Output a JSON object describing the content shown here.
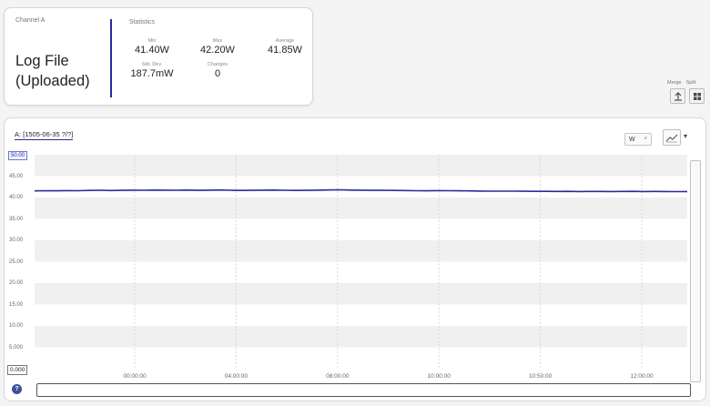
{
  "summary": {
    "channel_label": "Channel A",
    "log_title": "Log File\n(Uploaded)",
    "statistics_label": "Statistics",
    "stats": {
      "min": {
        "label": "Min",
        "value": "41.40W"
      },
      "max": {
        "label": "Max",
        "value": "42.20W"
      },
      "avg": {
        "label": "Average",
        "value": "41.85W"
      },
      "std": {
        "label": "Std. Dev.",
        "value": "187.7mW"
      },
      "changes": {
        "label": "Changes",
        "value": "0"
      }
    }
  },
  "view_controls": {
    "merge_label": "Merge",
    "split_label": "Split"
  },
  "chart_panel": {
    "title": "A: [1505-06-35 ?/?]",
    "unit_select": "W",
    "unit_arrow": "˅",
    "chart_type_caret": "▾",
    "help_label": "?"
  },
  "colors": {
    "series": "#2b2b9a",
    "accent": "#2b2b9a",
    "band": "#f0f0f0"
  },
  "icons": {
    "merge": "merge-icon",
    "split": "split-icon",
    "chart_type": "line-chart-icon",
    "help": "help-icon"
  },
  "chart_data": {
    "type": "line",
    "title": "",
    "xlabel": "",
    "ylabel": "",
    "y_top_label": "50.00",
    "y_ticks": [
      "45.00",
      "40.00",
      "35.00",
      "30.00",
      "25.00",
      "20.00",
      "15.00",
      "10.00",
      "5.000"
    ],
    "y_zero_label": "0.000",
    "x_ticks": [
      "00:00:00",
      "04:00:00",
      "08:00:00",
      "10:00:00",
      "10:50:00",
      "12:00:00"
    ],
    "ylim": [
      0,
      50
    ],
    "xlim": [
      0,
      12
    ],
    "grid": true,
    "series": [
      {
        "values": [
          41.55,
          41.6,
          41.58,
          41.62,
          41.6,
          41.65,
          41.7,
          41.63,
          41.68,
          41.72,
          41.7,
          41.75,
          41.72,
          41.7,
          41.74,
          41.68,
          41.72,
          41.76,
          41.7,
          41.65,
          41.68,
          41.72,
          41.74,
          41.7,
          41.66,
          41.68,
          41.72,
          41.76,
          41.8,
          41.75,
          41.72,
          41.68,
          41.7,
          41.66,
          41.64,
          41.6,
          41.58,
          41.62,
          41.6,
          41.57,
          41.55,
          41.52,
          41.5,
          41.48,
          41.5,
          41.46,
          41.44,
          41.45,
          41.42,
          41.44,
          41.41,
          41.42,
          41.43,
          41.4,
          41.42,
          41.44,
          41.41,
          41.43,
          41.4,
          41.38,
          41.4
        ]
      }
    ]
  }
}
